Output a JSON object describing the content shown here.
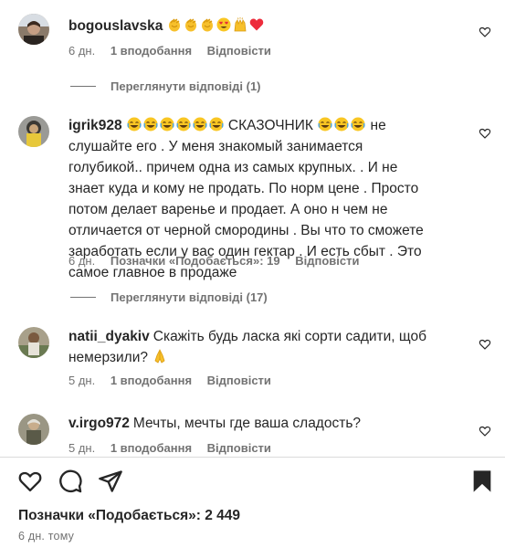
{
  "comments": [
    {
      "username": "bogouslavska",
      "text": "",
      "emojis": [
        "clapping-hands",
        "clapping-hands",
        "clapping-hands",
        "heart-eyes",
        "raising-hands",
        "red-heart"
      ],
      "time": "6 дн.",
      "likes": "1 вподобання",
      "reply": "Відповісти",
      "view_replies": "Переглянути відповіді (1)"
    },
    {
      "username": "igrik928",
      "text_emojis_before": [
        "tears-of-joy",
        "tears-of-joy",
        "tears-of-joy",
        "tears-of-joy",
        "tears-of-joy",
        "tears-of-joy"
      ],
      "text_part1": "СКАЗОЧНИК",
      "text_emojis_mid": [
        "tears-of-joy",
        "tears-of-joy",
        "tears-of-joy"
      ],
      "text_part2": "не слушайте его . У меня знакомый занимается голубикой.. причем одна из самых крупных. . И не знает куда и кому не продать. По норм цене . Просто потом делает варенье и продает. А оно н чем не отличается от черной смородины . Вы что то сможете заработать если у вас один гектар . И есть сбыт . Это самое главное в продаже",
      "time": "6 дн.",
      "likes": "Позначки «Подобається»: 19",
      "reply": "Відповісти",
      "view_replies": "Переглянути відповіді (17)"
    },
    {
      "username": "natii_dyakiv",
      "text": "Скажіть будь ласка які сорти садити, щоб немерзили?",
      "emojis": [
        "folded-hands"
      ],
      "time": "5 дн.",
      "likes": "1 вподобання",
      "reply": "Відповісти"
    },
    {
      "username": "v.irgo972",
      "text": "Мечты, мечты где ваша сладость?",
      "time": "5 дн.",
      "likes": "1 вподобання",
      "reply": "Відповісти"
    }
  ],
  "actions": {
    "like_icon": "heart-outline-icon",
    "comment_icon": "comment-icon",
    "share_icon": "paper-plane-icon",
    "save_icon": "bookmark-filled-icon"
  },
  "post": {
    "likes": "Позначки «Подобається»: 2 449",
    "time": "6 дн. тому"
  },
  "colors": {
    "text": "#262626",
    "secondary": "#737373",
    "divider": "#dbdbdb",
    "heart_red": "#ed2c3c",
    "emoji_yellow": "#f9c623"
  }
}
